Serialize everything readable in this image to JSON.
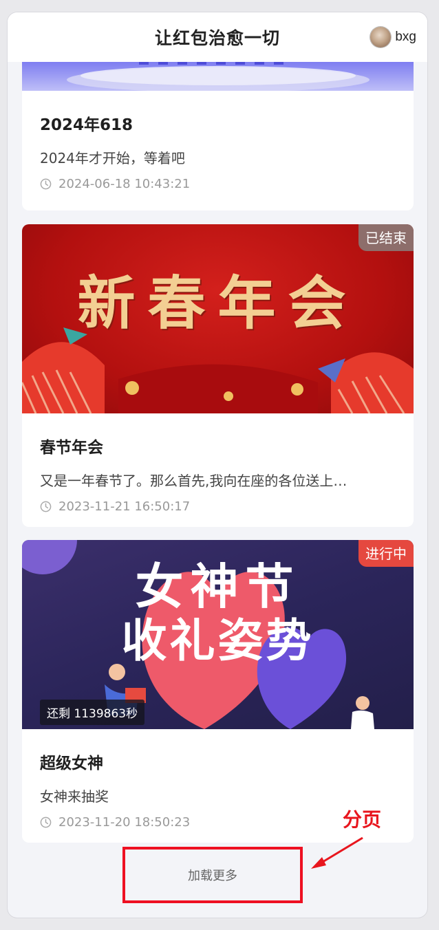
{
  "header": {
    "title": "让红包治愈一切",
    "username": "bxg"
  },
  "cards": [
    {
      "title": "2024年618",
      "desc": "2024年才开始，等着吧",
      "time": "2024-06-18 10:43:21"
    },
    {
      "title": "春节年会",
      "desc": "又是一年春节了。那么首先,我向在座的各位送上…",
      "time": "2023-11-21 16:50:17",
      "badge": "已结束",
      "cover_text": "新春年会"
    },
    {
      "title": "超级女神",
      "desc": "女神来抽奖",
      "time": "2023-11-20 18:50:23",
      "badge": "进行中",
      "countdown": "还剩 1139863秒",
      "cover_line1": "女神节",
      "cover_line2": "收礼姿势"
    }
  ],
  "load_more": "加载更多",
  "annotation": {
    "label": "分页"
  },
  "colors": {
    "ended_badge": "#8d6e6b",
    "running_badge": "#e5483f",
    "annotation_red": "#e8161e"
  }
}
